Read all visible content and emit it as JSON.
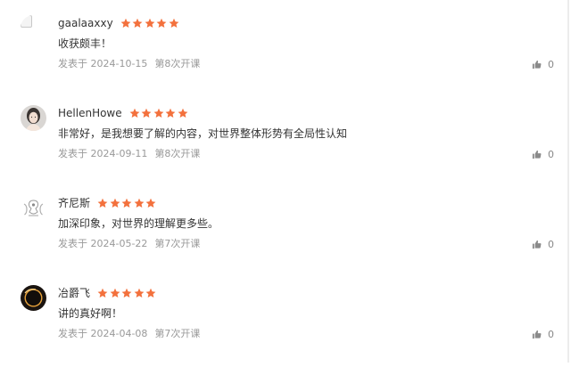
{
  "colors": {
    "star": "#f3713d",
    "meta": "#999999",
    "text": "#333333"
  },
  "reviews": [
    {
      "user": "gaalaaxxy",
      "avatar": "broken-image-icon",
      "rating": 5,
      "comment": "收获颇丰！",
      "date": "发表于 2024-10-15",
      "lesson": "第8次开课",
      "likes": "0"
    },
    {
      "user": "HellenHowe",
      "avatar": "woman-portrait",
      "rating": 5,
      "comment": "非常好，是我想要了解的内容，对世界整体形势有全局性认知",
      "date": "发表于 2024-09-11",
      "lesson": "第8次开课",
      "likes": "0"
    },
    {
      "user": "齐尼斯",
      "avatar": "crest-emblem",
      "rating": 5,
      "comment": "加深印象，对世界的理解更多些。",
      "date": "发表于 2024-05-22",
      "lesson": "第7次开课",
      "likes": "0"
    },
    {
      "user": "冶爵飞",
      "avatar": "eclipse-ring",
      "rating": 5,
      "comment": "讲的真好啊！",
      "date": "发表于 2024-04-08",
      "lesson": "第7次开课",
      "likes": "0"
    }
  ]
}
